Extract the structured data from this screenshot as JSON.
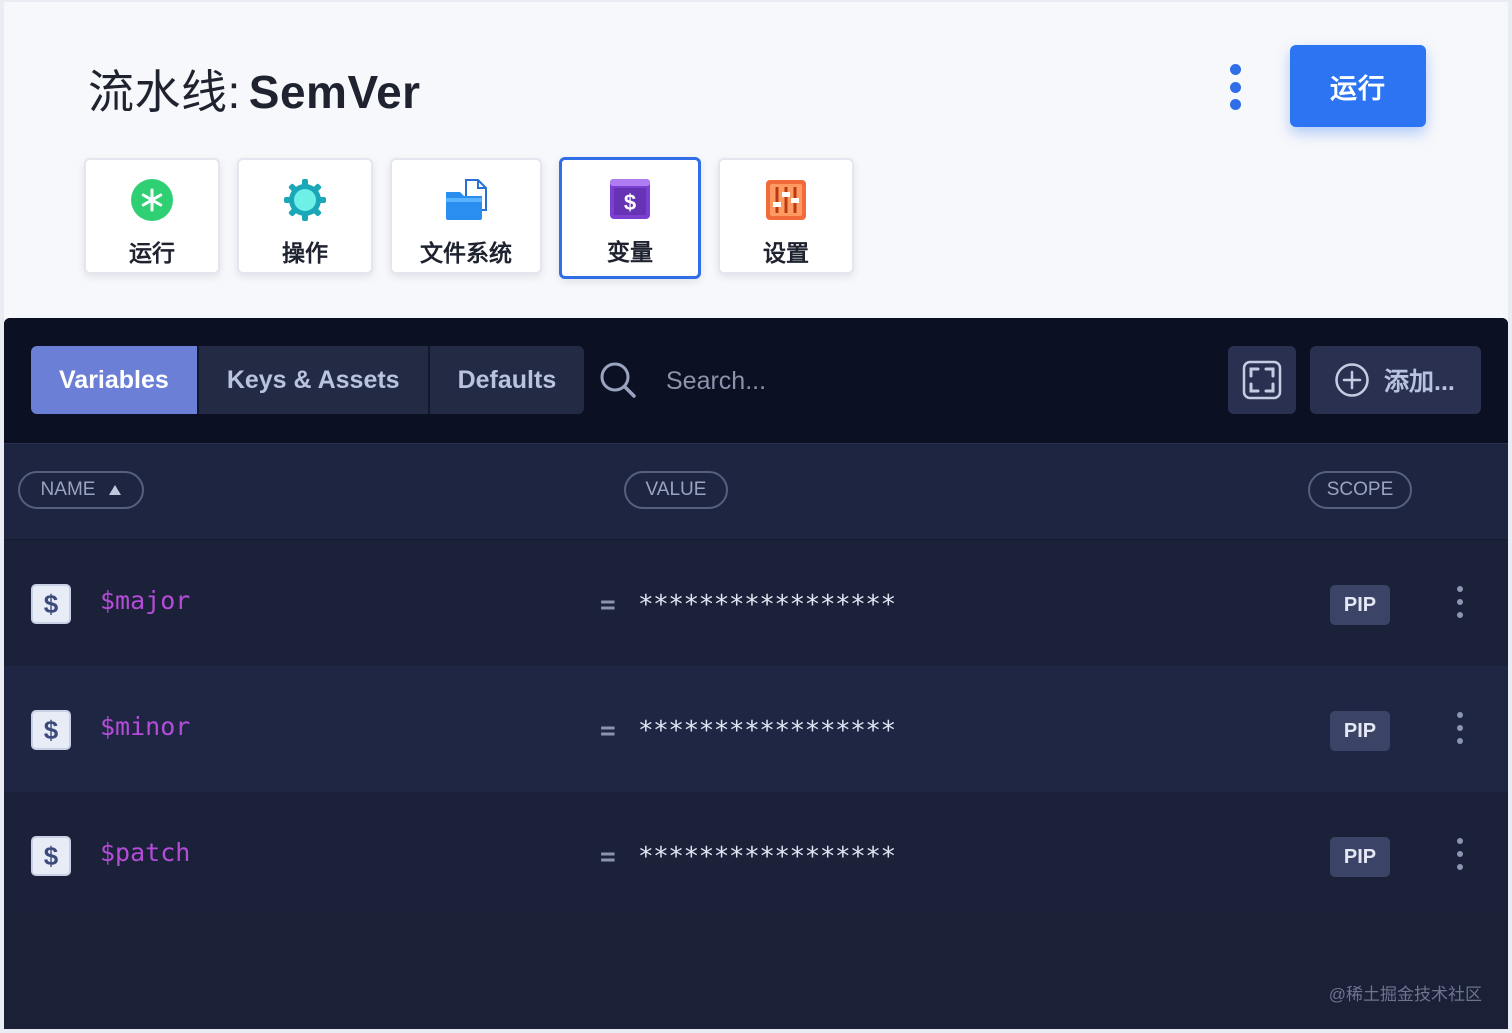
{
  "header": {
    "title_prefix": "流水线:",
    "title_name": "SemVer",
    "run_button": "运行"
  },
  "nav": [
    {
      "label": "运行",
      "icon": "asterisk-icon"
    },
    {
      "label": "操作",
      "icon": "gear-icon"
    },
    {
      "label": "文件系统",
      "icon": "folder-file-icon"
    },
    {
      "label": "变量",
      "icon": "dollar-icon"
    },
    {
      "label": "设置",
      "icon": "sliders-icon"
    }
  ],
  "active_nav": "变量",
  "toolbar": {
    "tabs": [
      "Variables",
      "Keys & Assets",
      "Defaults"
    ],
    "active_tab": "Variables",
    "search_placeholder": "Search...",
    "add_label": "添加..."
  },
  "columns": {
    "name": "NAME",
    "value": "VALUE",
    "scope": "SCOPE"
  },
  "rows": [
    {
      "icon": "$",
      "name": "$major",
      "eq": "=",
      "value": "*****************",
      "scope": "PIP"
    },
    {
      "icon": "$",
      "name": "$minor",
      "eq": "=",
      "value": "*****************",
      "scope": "PIP"
    },
    {
      "icon": "$",
      "name": "$patch",
      "eq": "=",
      "value": "*****************",
      "scope": "PIP"
    }
  ],
  "watermark": "@稀土掘金技术社区",
  "colors": {
    "accent": "#2c74f2",
    "active_tab": "#6b7fd6",
    "var_name": "#b54cd8",
    "panel_bg": "#1a2036"
  }
}
